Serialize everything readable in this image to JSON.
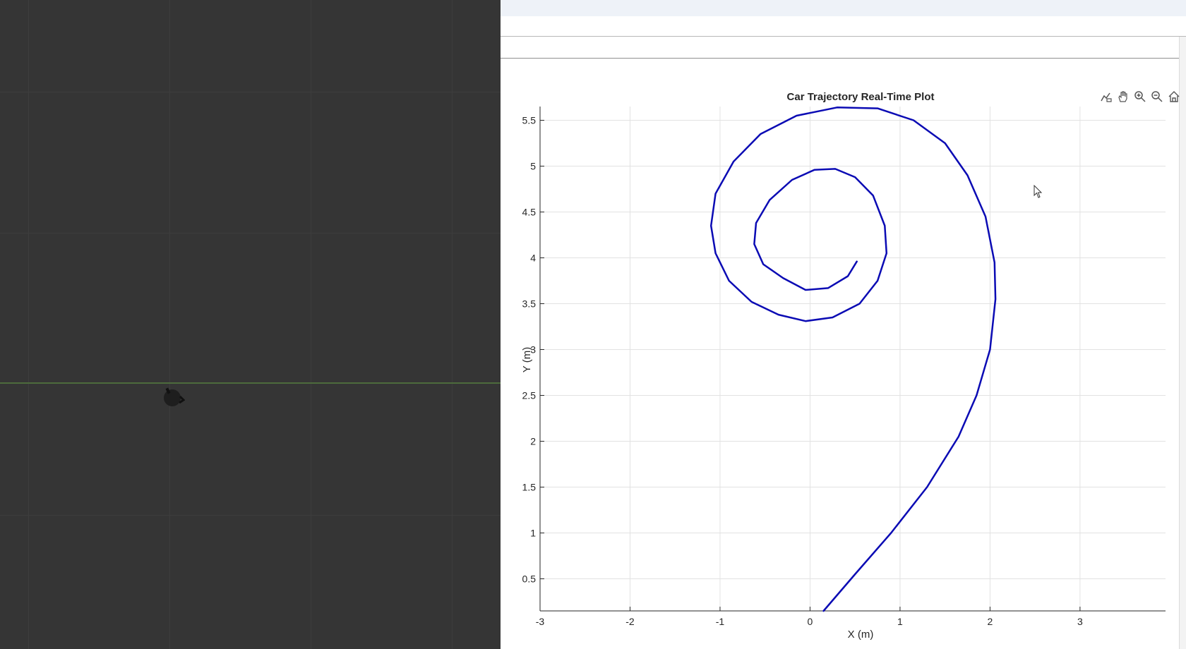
{
  "simulation": {
    "background": "#353535",
    "axis_line_color": "#4d6b3c"
  },
  "figure": {
    "toolbar": {
      "buttons": [
        {
          "name": "data-tips-icon"
        },
        {
          "name": "pan-hand-icon"
        },
        {
          "name": "zoom-in-icon"
        },
        {
          "name": "zoom-out-icon"
        },
        {
          "name": "restore-view-home-icon"
        }
      ]
    }
  },
  "chart_data": {
    "type": "line",
    "title": "Car Trajectory Real-Time Plot",
    "xlabel": "X (m)",
    "ylabel": "Y (m)",
    "xlim": [
      -3,
      3.95
    ],
    "ylim": [
      0.15,
      5.65
    ],
    "xticks": [
      "-3",
      "-2",
      "-1",
      "0",
      "1",
      "2",
      "3"
    ],
    "yticks": [
      "0.5",
      "1",
      "1.5",
      "2",
      "2.5",
      "3",
      "3.5",
      "4",
      "4.5",
      "5",
      "5.5"
    ],
    "grid": true,
    "line_color": "#0b0bb4",
    "series": [
      {
        "x": [
          0.15,
          0.5,
          0.9,
          1.3,
          1.65,
          1.85,
          2.0,
          2.06,
          2.05,
          1.95,
          1.75,
          1.5,
          1.15,
          0.75,
          0.3,
          -0.15,
          -0.55,
          -0.85,
          -1.05,
          -1.1,
          -1.05,
          -0.9,
          -0.65,
          -0.35,
          -0.05,
          0.25,
          0.55,
          0.75,
          0.85,
          0.83,
          0.7,
          0.5,
          0.28,
          0.05,
          -0.2,
          -0.45,
          -0.6,
          -0.62,
          -0.52,
          -0.3,
          -0.05,
          0.2,
          0.42,
          0.52
        ],
        "y": [
          0.15,
          0.55,
          1.0,
          1.5,
          2.05,
          2.5,
          3.0,
          3.55,
          3.95,
          4.45,
          4.9,
          5.25,
          5.5,
          5.63,
          5.64,
          5.55,
          5.35,
          5.05,
          4.7,
          4.35,
          4.05,
          3.75,
          3.52,
          3.38,
          3.31,
          3.35,
          3.5,
          3.75,
          4.05,
          4.35,
          4.68,
          4.88,
          4.97,
          4.96,
          4.85,
          4.63,
          4.38,
          4.15,
          3.93,
          3.78,
          3.65,
          3.67,
          3.8,
          3.96
        ]
      }
    ]
  }
}
